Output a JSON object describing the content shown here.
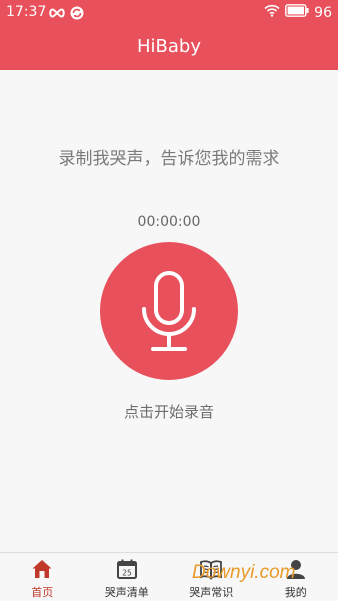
{
  "status_bar": {
    "time": "17:37",
    "battery": "96",
    "icons": [
      "infinity-icon",
      "sync-icon",
      "wifi-icon",
      "battery-icon"
    ]
  },
  "app": {
    "title": "HiBaby"
  },
  "main": {
    "prompt": "录制我哭声，告诉您我的需求",
    "timer": "00:00:00",
    "record_hint": "点击开始录音",
    "record_icon": "microphone-icon"
  },
  "bottom_nav": {
    "items": [
      {
        "label": "首页",
        "icon": "home-icon",
        "active": true
      },
      {
        "label": "哭声清单",
        "icon": "calendar-icon",
        "date_number": "25",
        "active": false
      },
      {
        "label": "哭声常识",
        "icon": "book-icon",
        "active": false
      },
      {
        "label": "我的",
        "icon": "person-icon",
        "active": false
      }
    ]
  },
  "watermark": "Downyi.com",
  "colors": {
    "primary": "#e8505b",
    "background": "#f7f7f7",
    "active_nav": "#c0392b"
  }
}
